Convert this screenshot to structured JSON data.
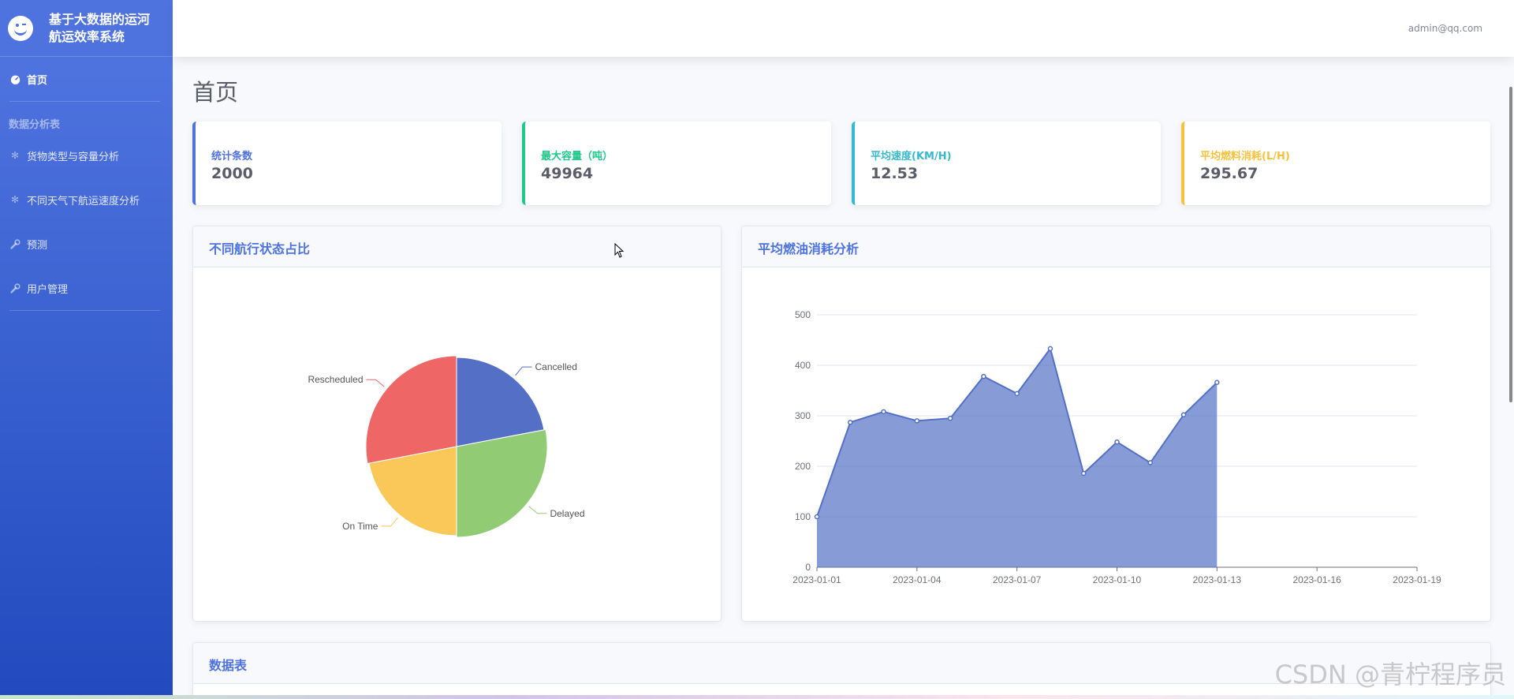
{
  "brand": {
    "title": "基于大数据的运河航运效率系统"
  },
  "sidebar": {
    "home": "首页",
    "section_heading": "数据分析表",
    "items": [
      {
        "label": "货物类型与容量分析",
        "icon": "gear-icon"
      },
      {
        "label": "不同天气下航运速度分析",
        "icon": "gear-icon"
      },
      {
        "label": "预测",
        "icon": "wrench-icon"
      },
      {
        "label": "用户管理",
        "icon": "wrench-icon"
      }
    ]
  },
  "topbar": {
    "user_email": "admin@qq.com"
  },
  "page": {
    "title": "首页"
  },
  "stats": [
    {
      "label": "统计条数",
      "value": "2000",
      "color": "#4e73df"
    },
    {
      "label": "最大容量（吨）",
      "value": "49964",
      "color": "#1cc88a"
    },
    {
      "label": "平均速度(KM/H)",
      "value": "12.53",
      "color": "#36b9cc"
    },
    {
      "label": "平均燃料消耗(L/H)",
      "value": "295.67",
      "color": "#f6c23e"
    }
  ],
  "panels": {
    "pie_title": "不同航行状态占比",
    "line_title": "平均燃油消耗分析",
    "table_title": "数据表"
  },
  "chart_data": [
    {
      "type": "pie",
      "title": "",
      "categories": [
        "Cancelled",
        "Delayed",
        "On Time",
        "Rescheduled"
      ],
      "values": [
        22,
        28,
        22,
        28
      ],
      "colors": [
        "#5470c6",
        "#91cc75",
        "#fac858",
        "#ee6666"
      ],
      "rose": true
    },
    {
      "type": "area",
      "title": "",
      "x": [
        "2023-01-01",
        "2023-01-02",
        "2023-01-03",
        "2023-01-04",
        "2023-01-05",
        "2023-01-06",
        "2023-01-07",
        "2023-01-08",
        "2023-01-09",
        "2023-01-10",
        "2023-01-11",
        "2023-01-12",
        "2023-01-13"
      ],
      "values": [
        100,
        287,
        308,
        290,
        295,
        378,
        344,
        433,
        186,
        248,
        207,
        302,
        366
      ],
      "x_ticks": [
        "2023-01-01",
        "2023-01-04",
        "2023-01-07",
        "2023-01-10",
        "2023-01-13",
        "2023-01-16",
        "2023-01-19"
      ],
      "y_ticks": [
        0,
        100,
        200,
        300,
        400,
        500
      ],
      "ylim": [
        0,
        500
      ],
      "color": "#5470c6",
      "grid": true
    }
  ],
  "watermark": "CSDN @青柠程序员"
}
